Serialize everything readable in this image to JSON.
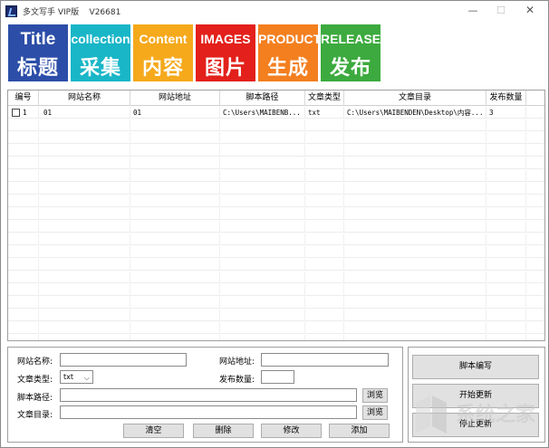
{
  "window": {
    "title": "多文写手 VIP版    V26681",
    "controls": {
      "minimize": "—",
      "maximize": "☐",
      "close": "✕"
    }
  },
  "tiles": [
    {
      "en": "Title",
      "zh": "标题",
      "color": "#2d4ea8"
    },
    {
      "en": "collection",
      "zh": "采集",
      "color": "#19b6c7"
    },
    {
      "en": "Content",
      "zh": "内容",
      "color": "#f5a91b"
    },
    {
      "en": "IMAGES",
      "zh": "图片",
      "color": "#e3201b"
    },
    {
      "en": "PRODUCT..",
      "zh": "生成",
      "color": "#f47f1f"
    },
    {
      "en": "RELEASE",
      "zh": "发布",
      "color": "#3caa3e"
    }
  ],
  "table": {
    "headers": [
      "编号",
      "网站名称",
      "网站地址",
      "脚本路径",
      "文章类型",
      "文章目录",
      "发布数量"
    ],
    "rows": [
      [
        "1",
        "01",
        "01",
        "C:\\Users\\MAIBENB...",
        "txt",
        "C:\\Users\\MAIBENDEN\\Desktop\\内容...",
        "3"
      ]
    ]
  },
  "form": {
    "site_name_label": "网站名称:",
    "site_name_value": "",
    "site_url_label": "网站地址:",
    "site_url_value": "",
    "article_type_label": "文章类型:",
    "article_type_value": "txt",
    "publish_count_label": "发布数量:",
    "publish_count_value": "",
    "script_path_label": "脚本路径:",
    "script_path_value": "",
    "article_dir_label": "文章目录:",
    "article_dir_value": "",
    "browse_label": "浏览",
    "clear_label": "清空",
    "delete_label": "删除",
    "modify_label": "修改",
    "add_label": "添加"
  },
  "side": {
    "script_edit_label": "脚本编写",
    "start_update_label": "开始更新",
    "stop_update_label": "停止更新"
  },
  "watermark": {
    "text": "系统之家"
  }
}
